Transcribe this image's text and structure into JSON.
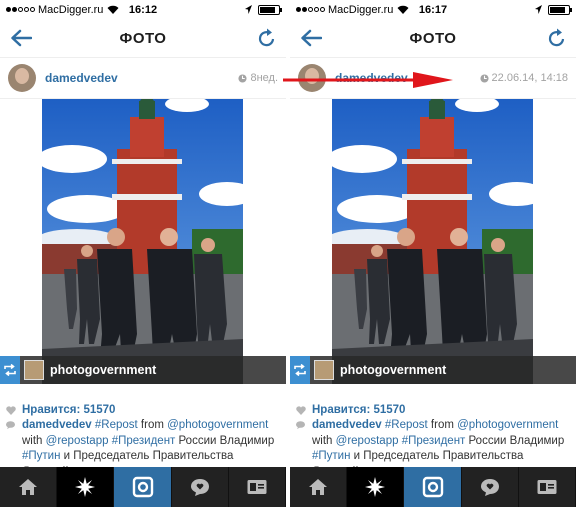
{
  "screens": [
    {
      "carrier": "MacDigger.ru",
      "time": "16:12",
      "title": "ФОТО",
      "username": "damedvedev",
      "timestamp": "8нед.",
      "repost_name": "photogovernment",
      "likes": "Нравится: 51570",
      "caption": {
        "user": "damedvedev",
        "tag1": "#Repost",
        "t1": " from ",
        "mention1": "@photogovernment",
        "t2": " with ",
        "mention2": "@repostapp",
        "tag2": "#Президент",
        "t3": " России Владимир ",
        "tag3": "#Путин",
        "t4": " и Председатель Правительства Дмитрий"
      }
    },
    {
      "carrier": "MacDigger.ru",
      "time": "16:17",
      "title": "ФОТО",
      "username": "damedvedev",
      "timestamp": "22.06.14, 14:18",
      "repost_name": "photogovernment",
      "likes": "Нравится: 51570",
      "caption": {
        "user": "damedvedev",
        "tag1": "#Repost",
        "t1": " from ",
        "mention1": "@photogovernment",
        "t2": " with ",
        "mention2": "@repostapp",
        "tag2": "#Президент",
        "t3": " России Владимир ",
        "tag3": "#Путин",
        "t4": " и Председатель Правительства Дмитрий"
      }
    }
  ],
  "battery_level": 0.85,
  "colors": {
    "accent": "#2f6ea3",
    "active_tab": "#2f6ea3",
    "arrow": "#e0161b"
  },
  "icons": [
    "back-arrow-icon",
    "refresh-icon",
    "clock-icon",
    "repost-icon",
    "heart-icon",
    "comment-bubble-icon",
    "home-icon",
    "explore-star-icon",
    "camera-icon",
    "activity-bubble-icon",
    "profile-card-icon"
  ]
}
